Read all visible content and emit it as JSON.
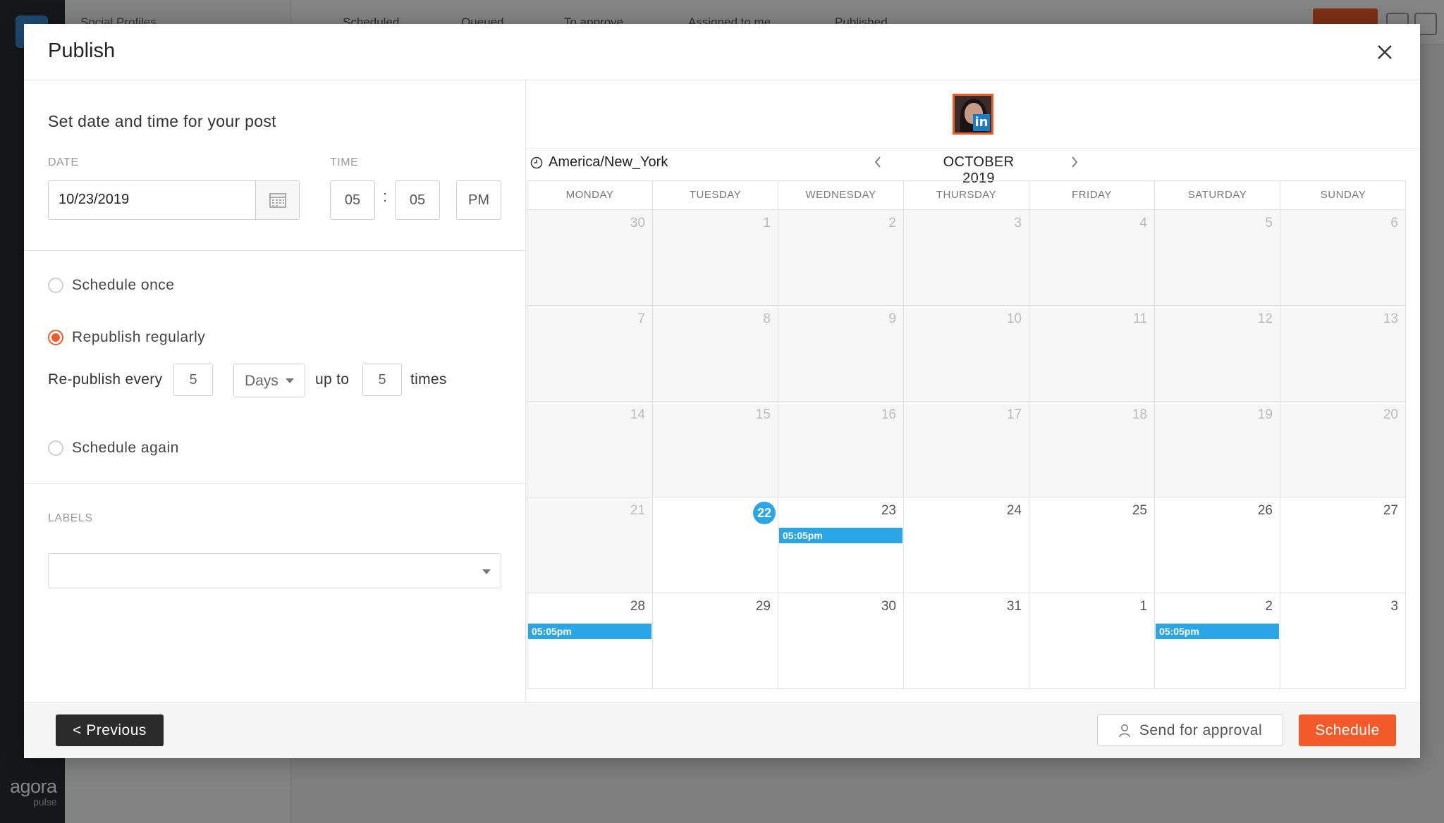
{
  "background": {
    "tabs": [
      "Scheduled",
      "Queued",
      "To approve",
      "Assigned to me",
      "Published"
    ],
    "panel_title": "Social Profiles",
    "brand_name": "agora",
    "brand_sub": "pulse"
  },
  "modal": {
    "title": "Publish",
    "close_icon": "close-icon",
    "section_title": "Set date and time for your post",
    "date_label": "DATE",
    "date_value": "10/23/2019",
    "time_label": "TIME",
    "time_hour": "05",
    "time_colon": ":",
    "time_minute": "05",
    "time_ampm": "PM",
    "options": {
      "schedule_once": "Schedule once",
      "republish_regularly": "Republish regularly",
      "schedule_again": "Schedule again",
      "selected": "republish_regularly"
    },
    "republish": {
      "prefix": "Re-publish every",
      "interval": "5",
      "unit": "Days",
      "upto": "up to",
      "count": "5",
      "suffix": "times"
    },
    "labels_label": "LABELS",
    "labels_value": ""
  },
  "calendar": {
    "timezone": "America/New_York",
    "month": "OCTOBER 2019",
    "weekdays": [
      "MONDAY",
      "TUESDAY",
      "WEDNESDAY",
      "THURSDAY",
      "FRIDAY",
      "SATURDAY",
      "SUNDAY"
    ],
    "days": [
      {
        "n": "30",
        "past": true
      },
      {
        "n": "1",
        "past": true
      },
      {
        "n": "2",
        "past": true
      },
      {
        "n": "3",
        "past": true
      },
      {
        "n": "4",
        "past": true
      },
      {
        "n": "5",
        "past": true
      },
      {
        "n": "6",
        "past": true
      },
      {
        "n": "7",
        "past": true
      },
      {
        "n": "8",
        "past": true
      },
      {
        "n": "9",
        "past": true
      },
      {
        "n": "10",
        "past": true
      },
      {
        "n": "11",
        "past": true
      },
      {
        "n": "12",
        "past": true
      },
      {
        "n": "13",
        "past": true
      },
      {
        "n": "14",
        "past": true
      },
      {
        "n": "15",
        "past": true
      },
      {
        "n": "16",
        "past": true
      },
      {
        "n": "17",
        "past": true
      },
      {
        "n": "18",
        "past": true
      },
      {
        "n": "19",
        "past": true
      },
      {
        "n": "20",
        "past": true
      },
      {
        "n": "21",
        "past": true
      },
      {
        "n": "22",
        "today": true
      },
      {
        "n": "23",
        "event": "05:05pm"
      },
      {
        "n": "24"
      },
      {
        "n": "25"
      },
      {
        "n": "26"
      },
      {
        "n": "27"
      },
      {
        "n": "28",
        "event": "05:05pm"
      },
      {
        "n": "29"
      },
      {
        "n": "30"
      },
      {
        "n": "31"
      },
      {
        "n": "1"
      },
      {
        "n": "2",
        "event": "05:05pm"
      },
      {
        "n": "3"
      }
    ]
  },
  "footer": {
    "previous": "< Previous",
    "send_for_approval": "Send for approval",
    "schedule": "Schedule"
  },
  "colors": {
    "accent": "#f25a2a",
    "event": "#2aa5e8",
    "dark_button": "#2b2b2b"
  }
}
